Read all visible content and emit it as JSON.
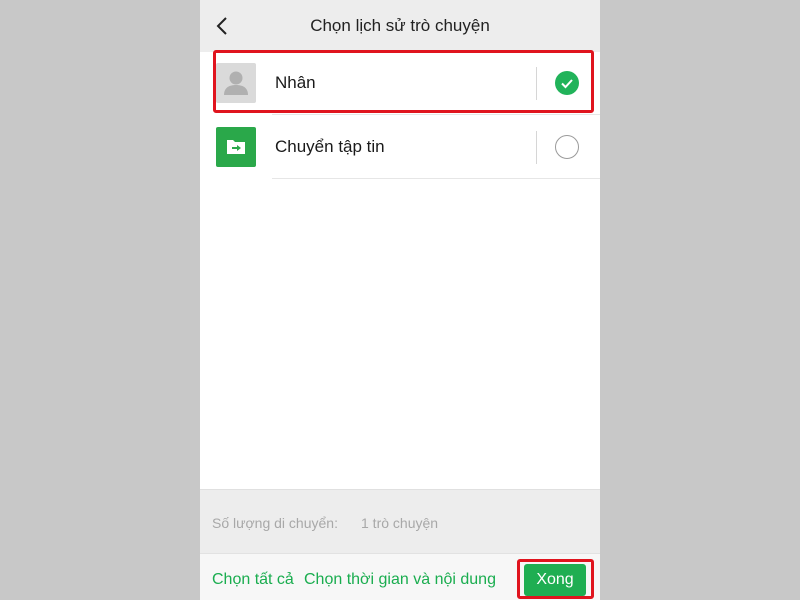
{
  "header": {
    "title": "Chọn lịch sử trò chuyện",
    "back_icon": "chevron-left-icon"
  },
  "chats": [
    {
      "name": "Nhân",
      "avatar": "user-avatar-icon",
      "selected": true
    },
    {
      "name": "Chuyển tập tin",
      "avatar": "file-transfer-icon",
      "selected": false
    }
  ],
  "footer": {
    "count_label": "Số lượng di chuyển:",
    "count_value": "1 trò chuyện",
    "select_all": "Chọn tất cả",
    "select_time": "Chọn thời gian và nội dung",
    "done": "Xong"
  },
  "colors": {
    "accent": "#1fae52",
    "highlight": "#e0141e"
  }
}
